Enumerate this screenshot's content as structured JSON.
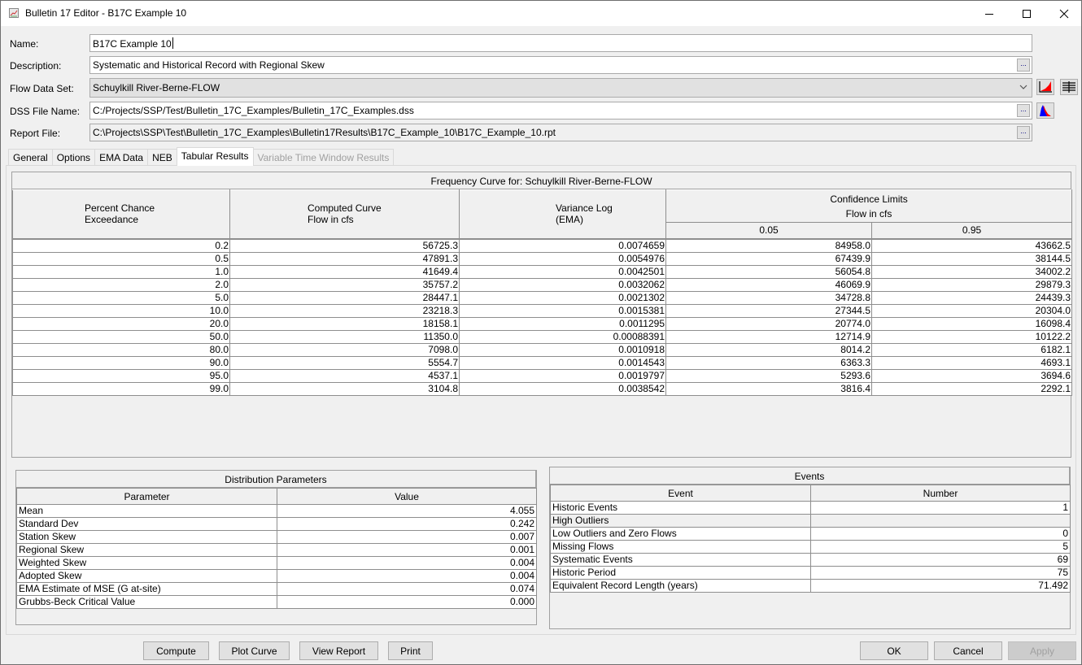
{
  "window": {
    "title": "Bulletin 17 Editor - B17C Example 10",
    "controls": [
      "minimize",
      "maximize",
      "close"
    ]
  },
  "form": {
    "name_label": "Name:",
    "name_value": "B17C Example 10",
    "description_label": "Description:",
    "description_value": "Systematic and Historical Record with Regional Skew",
    "flow_data_set_label": "Flow Data Set:",
    "flow_data_set_value": "Schuylkill River-Berne-FLOW",
    "dss_file_label": "DSS File Name:",
    "dss_file_value": "C:/Projects/SSP/Test/Bulletin_17C_Examples/Bulletin_17C_Examples.dss",
    "report_file_label": "Report File:",
    "report_file_value": "C:\\Projects\\SSP\\Test\\Bulletin_17C_Examples\\Bulletin17Results\\B17C_Example_10\\B17C_Example_10.rpt",
    "ellipsis": "..."
  },
  "tabs": [
    {
      "label": "General",
      "state": "normal"
    },
    {
      "label": "Options",
      "state": "normal"
    },
    {
      "label": "EMA Data",
      "state": "normal"
    },
    {
      "label": "NEB",
      "state": "normal"
    },
    {
      "label": "Tabular Results",
      "state": "active"
    },
    {
      "label": "Variable Time Window Results",
      "state": "disabled"
    }
  ],
  "frequency": {
    "title": "Frequency Curve for: Schuylkill River-Berne-FLOW",
    "headers": {
      "pce": [
        "Percent Chance",
        "Exceedance"
      ],
      "computed": [
        "Computed Curve",
        "Flow in cfs"
      ],
      "variance": [
        "Variance Log",
        "(EMA)"
      ],
      "confidence": [
        "Confidence Limits",
        "Flow in cfs"
      ],
      "conf_05": "0.05",
      "conf_95": "0.95"
    },
    "rows": [
      [
        "0.2",
        "56725.3",
        "0.0074659",
        "84958.0",
        "43662.5"
      ],
      [
        "0.5",
        "47891.3",
        "0.0054976",
        "67439.9",
        "38144.5"
      ],
      [
        "1.0",
        "41649.4",
        "0.0042501",
        "56054.8",
        "34002.2"
      ],
      [
        "2.0",
        "35757.2",
        "0.0032062",
        "46069.9",
        "29879.3"
      ],
      [
        "5.0",
        "28447.1",
        "0.0021302",
        "34728.8",
        "24439.3"
      ],
      [
        "10.0",
        "23218.3",
        "0.0015381",
        "27344.5",
        "20304.0"
      ],
      [
        "20.0",
        "18158.1",
        "0.0011295",
        "20774.0",
        "16098.4"
      ],
      [
        "50.0",
        "11350.0",
        "0.00088391",
        "12714.9",
        "10122.2"
      ],
      [
        "80.0",
        "7098.0",
        "0.0010918",
        "8014.2",
        "6182.1"
      ],
      [
        "90.0",
        "5554.7",
        "0.0014543",
        "6363.3",
        "4693.1"
      ],
      [
        "95.0",
        "4537.1",
        "0.0019797",
        "5293.6",
        "3694.6"
      ],
      [
        "99.0",
        "3104.8",
        "0.0038542",
        "3816.4",
        "2292.1"
      ]
    ]
  },
  "distribution": {
    "title": "Distribution Parameters",
    "col_parameter": "Parameter",
    "col_value": "Value",
    "rows": [
      [
        "Mean",
        "4.055"
      ],
      [
        "Standard Dev",
        "0.242"
      ],
      [
        "Station Skew",
        "0.007"
      ],
      [
        "Regional Skew",
        "0.001"
      ],
      [
        "Weighted Skew",
        "0.004"
      ],
      [
        "Adopted Skew",
        "0.004"
      ],
      [
        "EMA Estimate of MSE (G at-site)",
        "0.074"
      ],
      [
        "Grubbs-Beck Critical Value",
        "0.000"
      ]
    ]
  },
  "events": {
    "title": "Events",
    "col_event": "Event",
    "col_number": "Number",
    "rows": [
      [
        "Historic Events",
        "1"
      ],
      [
        "High Outliers",
        ""
      ],
      [
        "Low Outliers and Zero Flows",
        "0"
      ],
      [
        "Missing Flows",
        "5"
      ],
      [
        "Systematic Events",
        "69"
      ],
      [
        "Historic Period",
        "75"
      ],
      [
        "Equivalent Record Length (years)",
        "71.492"
      ]
    ]
  },
  "buttons": {
    "compute": "Compute",
    "plot_curve": "Plot Curve",
    "view_report": "View Report",
    "print": "Print",
    "ok": "OK",
    "cancel": "Cancel",
    "apply": "Apply"
  },
  "icons": {
    "plot_frequency": "frequency-plot-icon",
    "table": "table-icon",
    "dss_plot": "distribution-plot-icon"
  }
}
